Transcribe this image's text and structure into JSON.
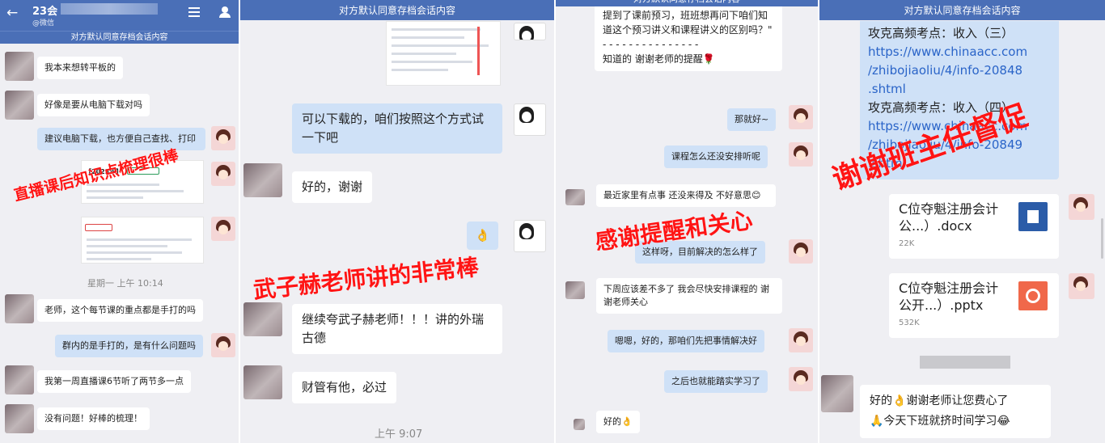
{
  "banner_text": "对方默认同意存档会话内容",
  "panel1": {
    "header": {
      "title": "23会",
      "sub": "@微信"
    },
    "messages": [
      "我本来想转平板的",
      "好像是要从电脑下载对吗",
      "建议电脑下载，也方便自己查找、打印",
      "老师，这个每节课的重点都是手打的吗",
      "群内的是手打的，是有什么问题吗",
      "我第一周直播课6节听了两节多一点",
      "没有问题！好棒的梳理！"
    ],
    "shot_label": "【2023年】",
    "time": "星期一 上午 10:14",
    "stamp": "直播课后知识点梳理很棒"
  },
  "panel2": {
    "messages": [
      "可以下载的，咱们按照这个方式试一下吧",
      "好的，谢谢",
      "👌",
      "继续夸武子赫老师！！！讲的外瑞古德",
      "财管有他，必过"
    ],
    "time": "上午 9:07",
    "stamp": "武子赫老师讲的非常棒"
  },
  "panel3": {
    "messages": [
      "提到了课前预习，班班想再问下咱们知道这个预习讲义和课程讲义的区别吗？\"\n- - - - - - - - - - - - - - -\n知道的  谢谢老师的提醒🌹",
      "那就好~",
      "课程怎么还没安排听呢",
      "最近家里有点事  还没来得及  不好意思😊",
      "这样呀，目前解决的怎么样了",
      "下周应该差不多了  我会尽快安排课程的  谢谢老师关心",
      "嗯嗯，好的，那咱们先把事情解决好",
      "之后也就能踏实学习了",
      "好的👌"
    ],
    "stamp": "感谢提醒和关心"
  },
  "panel4": {
    "link_block": [
      "攻克高频考点：收入（三）",
      "https://www.chinaacc.com",
      "/zhibojiaoliu/4/info-20848",
      ".shtml",
      "攻克高频考点：收入（四）",
      "https://www.chinaacc.com",
      "/zhibojiaoliu/4/info-20849",
      ".shtml"
    ],
    "files": [
      {
        "name": "C位夺魁注册会计公...）.docx",
        "size": "22K",
        "icon": "doc-icon",
        "color": "#2b5ca8"
      },
      {
        "name": "C位夺魁注册会计公开...）.pptx",
        "size": "532K",
        "icon": "ppt-icon",
        "color": "#f0684a"
      }
    ],
    "last_message": "好的👌谢谢老师让您费心了\n🙏今天下班就挤时间学习😂",
    "stamp": "谢谢班主任督促"
  }
}
